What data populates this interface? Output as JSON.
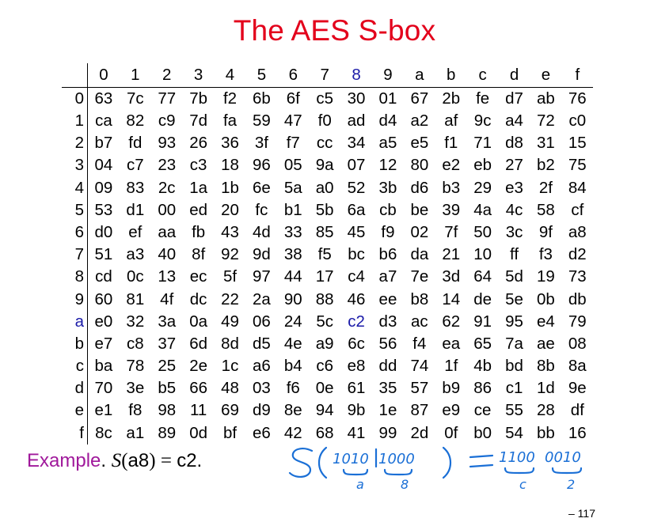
{
  "title": "The AES S-box",
  "table": {
    "col_headers": [
      "0",
      "1",
      "2",
      "3",
      "4",
      "5",
      "6",
      "7",
      "8",
      "9",
      "a",
      "b",
      "c",
      "d",
      "e",
      "f"
    ],
    "rows": [
      {
        "label": "0",
        "cells": [
          "63",
          "7c",
          "77",
          "7b",
          "f2",
          "6b",
          "6f",
          "c5",
          "30",
          "01",
          "67",
          "2b",
          "fe",
          "d7",
          "ab",
          "76"
        ]
      },
      {
        "label": "1",
        "cells": [
          "ca",
          "82",
          "c9",
          "7d",
          "fa",
          "59",
          "47",
          "f0",
          "ad",
          "d4",
          "a2",
          "af",
          "9c",
          "a4",
          "72",
          "c0"
        ]
      },
      {
        "label": "2",
        "cells": [
          "b7",
          "fd",
          "93",
          "26",
          "36",
          "3f",
          "f7",
          "cc",
          "34",
          "a5",
          "e5",
          "f1",
          "71",
          "d8",
          "31",
          "15"
        ]
      },
      {
        "label": "3",
        "cells": [
          "04",
          "c7",
          "23",
          "c3",
          "18",
          "96",
          "05",
          "9a",
          "07",
          "12",
          "80",
          "e2",
          "eb",
          "27",
          "b2",
          "75"
        ]
      },
      {
        "label": "4",
        "cells": [
          "09",
          "83",
          "2c",
          "1a",
          "1b",
          "6e",
          "5a",
          "a0",
          "52",
          "3b",
          "d6",
          "b3",
          "29",
          "e3",
          "2f",
          "84"
        ]
      },
      {
        "label": "5",
        "cells": [
          "53",
          "d1",
          "00",
          "ed",
          "20",
          "fc",
          "b1",
          "5b",
          "6a",
          "cb",
          "be",
          "39",
          "4a",
          "4c",
          "58",
          "cf"
        ]
      },
      {
        "label": "6",
        "cells": [
          "d0",
          "ef",
          "aa",
          "fb",
          "43",
          "4d",
          "33",
          "85",
          "45",
          "f9",
          "02",
          "7f",
          "50",
          "3c",
          "9f",
          "a8"
        ]
      },
      {
        "label": "7",
        "cells": [
          "51",
          "a3",
          "40",
          "8f",
          "92",
          "9d",
          "38",
          "f5",
          "bc",
          "b6",
          "da",
          "21",
          "10",
          "ff",
          "f3",
          "d2"
        ]
      },
      {
        "label": "8",
        "cells": [
          "cd",
          "0c",
          "13",
          "ec",
          "5f",
          "97",
          "44",
          "17",
          "c4",
          "a7",
          "7e",
          "3d",
          "64",
          "5d",
          "19",
          "73"
        ]
      },
      {
        "label": "9",
        "cells": [
          "60",
          "81",
          "4f",
          "dc",
          "22",
          "2a",
          "90",
          "88",
          "46",
          "ee",
          "b8",
          "14",
          "de",
          "5e",
          "0b",
          "db"
        ]
      },
      {
        "label": "a",
        "cells": [
          "e0",
          "32",
          "3a",
          "0a",
          "49",
          "06",
          "24",
          "5c",
          "c2",
          "d3",
          "ac",
          "62",
          "91",
          "95",
          "e4",
          "79"
        ]
      },
      {
        "label": "b",
        "cells": [
          "e7",
          "c8",
          "37",
          "6d",
          "8d",
          "d5",
          "4e",
          "a9",
          "6c",
          "56",
          "f4",
          "ea",
          "65",
          "7a",
          "ae",
          "08"
        ]
      },
      {
        "label": "c",
        "cells": [
          "ba",
          "78",
          "25",
          "2e",
          "1c",
          "a6",
          "b4",
          "c6",
          "e8",
          "dd",
          "74",
          "1f",
          "4b",
          "bd",
          "8b",
          "8a"
        ]
      },
      {
        "label": "d",
        "cells": [
          "70",
          "3e",
          "b5",
          "66",
          "48",
          "03",
          "f6",
          "0e",
          "61",
          "35",
          "57",
          "b9",
          "86",
          "c1",
          "1d",
          "9e"
        ]
      },
      {
        "label": "e",
        "cells": [
          "e1",
          "f8",
          "98",
          "11",
          "69",
          "d9",
          "8e",
          "94",
          "9b",
          "1e",
          "87",
          "e9",
          "ce",
          "55",
          "28",
          "df"
        ]
      },
      {
        "label": "f",
        "cells": [
          "8c",
          "a1",
          "89",
          "0d",
          "bf",
          "e6",
          "42",
          "68",
          "41",
          "99",
          "2d",
          "0f",
          "b0",
          "54",
          "bb",
          "16"
        ]
      }
    ],
    "highlight_row": 10,
    "highlight_col": 8,
    "highlight_color": "#1a1aa8"
  },
  "example": {
    "label": "Example",
    "after_label": ".",
    "fn": "S",
    "arg_open": "(",
    "arg": "a8",
    "arg_close": ")",
    "eq": " = ",
    "result": "c2",
    "end": "."
  },
  "handwriting": {
    "color": "#1a6fd6",
    "line1_lhs": "S(1010 1000)",
    "equals": "=",
    "line1_rhs": "1100 0010",
    "under": [
      "a",
      "8",
      "c",
      "2"
    ]
  },
  "page_number": "– 117",
  "colors": {
    "title": "#e3001b",
    "example_label": "#a0199b",
    "highlight": "#1a1aa8",
    "ink": "#1a6fd6"
  }
}
